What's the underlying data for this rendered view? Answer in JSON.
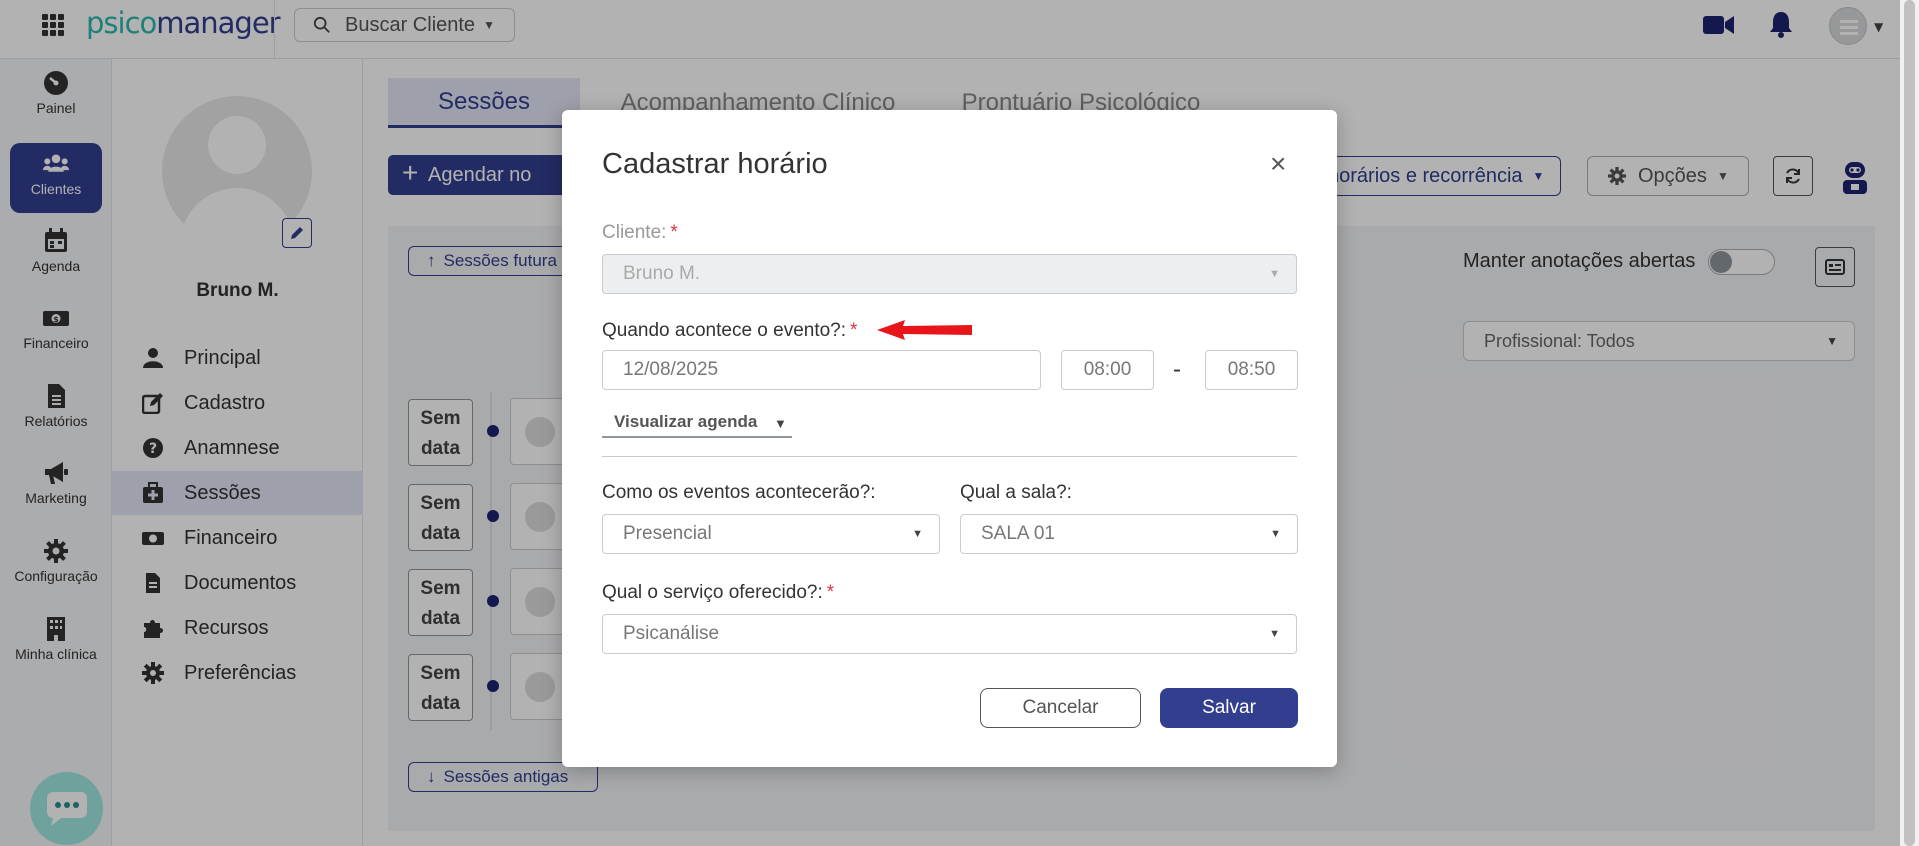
{
  "topbar": {
    "logo_a": "psico",
    "logo_b": "manager",
    "search_placeholder": "Buscar Cliente"
  },
  "leftnav": [
    {
      "label": "Painel",
      "icon": "gauge-icon"
    },
    {
      "label": "Clientes",
      "icon": "users-icon"
    },
    {
      "label": "Agenda",
      "icon": "calendar-icon"
    },
    {
      "label": "Financeiro",
      "icon": "money-icon"
    },
    {
      "label": "Relatórios",
      "icon": "file-icon"
    },
    {
      "label": "Marketing",
      "icon": "megaphone-icon"
    },
    {
      "label": "Configuração",
      "icon": "gear-icon"
    },
    {
      "label": "Minha clínica",
      "icon": "building-icon"
    }
  ],
  "patient": {
    "name": "Bruno M."
  },
  "subnav": [
    {
      "label": "Principal",
      "icon": "user-icon"
    },
    {
      "label": "Cadastro",
      "icon": "edit-icon"
    },
    {
      "label": "Anamnese",
      "icon": "question-icon"
    },
    {
      "label": "Sessões",
      "icon": "briefcase-medical-icon"
    },
    {
      "label": "Financeiro",
      "icon": "money-icon"
    },
    {
      "label": "Documentos",
      "icon": "file-icon"
    },
    {
      "label": "Recursos",
      "icon": "puzzle-icon"
    },
    {
      "label": "Preferências",
      "icon": "gear-icon"
    }
  ],
  "tabs": [
    {
      "label": "Sessões"
    },
    {
      "label": "Acompanhamento Clínico"
    },
    {
      "label": "Prontuário Psicológico"
    }
  ],
  "toolbar": {
    "agendar": "Agendar no",
    "horarios": "horários e recorrência",
    "opcoes": "Opções"
  },
  "sessions": {
    "futuras": "Sessões futura",
    "antigas": "Sessões antigas",
    "manter": "Manter anotações abertas",
    "profissional": "Profissional: Todos",
    "sem_data": [
      "Sem data",
      "Sem data",
      "Sem data",
      "Sem data"
    ]
  },
  "modal": {
    "title": "Cadastrar horário",
    "close": "×",
    "cliente_label": "Cliente:",
    "cliente_value": "Bruno M.",
    "quando_label": "Quando acontece o evento?:",
    "date": "12/08/2025",
    "start": "08:00",
    "end": "08:50",
    "dash": "-",
    "visualizar": "Visualizar agenda",
    "como_label": "Como os eventos acontecerão?:",
    "como_value": "Presencial",
    "sala_label": "Qual a sala?:",
    "sala_value": "SALA 01",
    "servico_label": "Qual o serviço oferecido?:",
    "servico_value": "Psicanálise",
    "required_mark": "*",
    "cancel": "Cancelar",
    "save": "Salvar"
  },
  "colors": {
    "brand": "#323e8e",
    "accent": "#2bb8b0",
    "required": "#dc3545",
    "arrow": "#e8151a"
  }
}
